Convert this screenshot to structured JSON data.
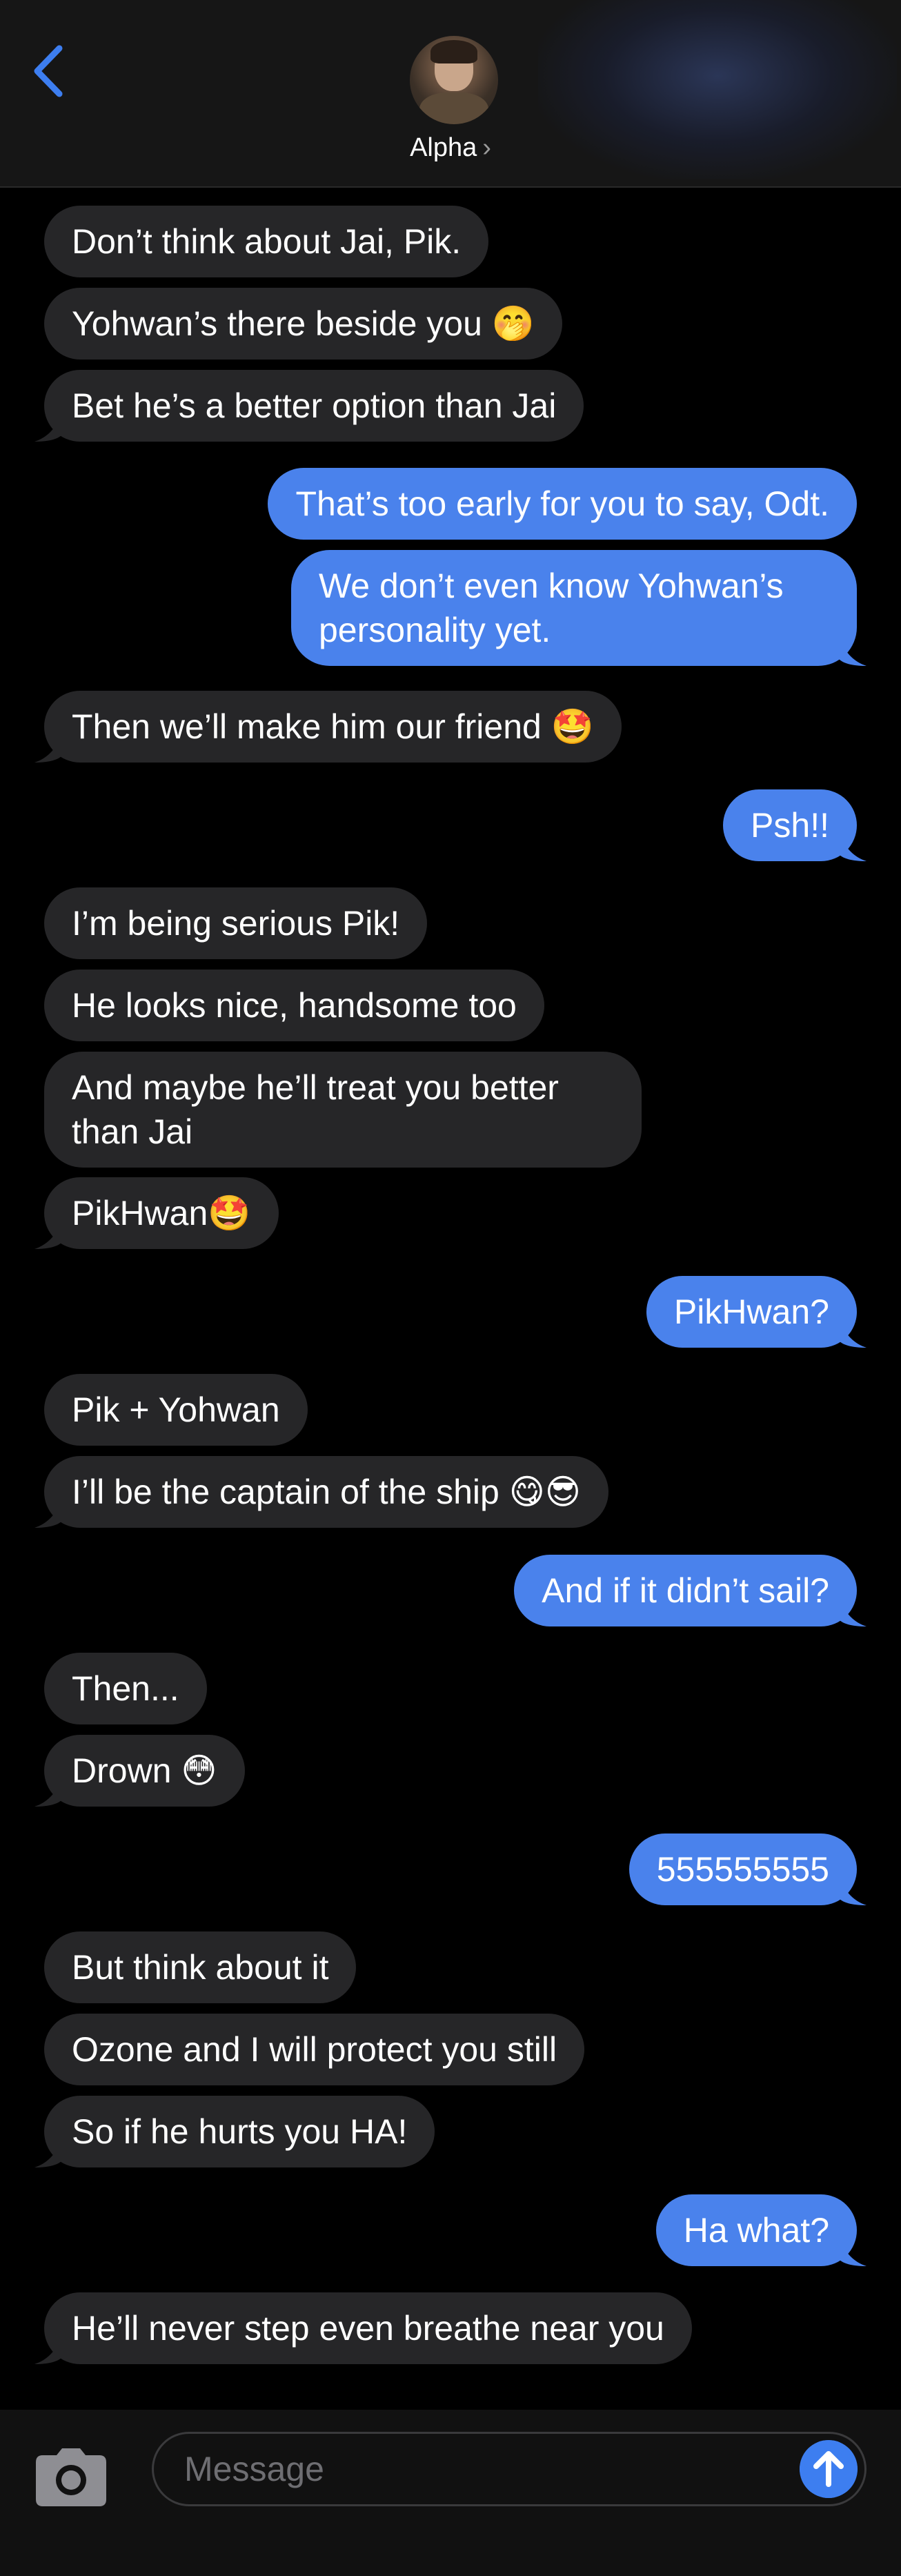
{
  "header": {
    "contact_name": "Alpha",
    "chevron": "›",
    "back_icon": "chevron-left-icon",
    "accent": "#4a82ec"
  },
  "messages": [
    {
      "dir": "in",
      "text": "Don’t think about Jai, Pik."
    },
    {
      "dir": "in",
      "text": "Yohwan’s there beside you 🤭"
    },
    {
      "dir": "in",
      "text": "Bet he’s a better option than Jai"
    },
    {
      "dir": "out",
      "text": "That’s too early for you to say, Odt."
    },
    {
      "dir": "out",
      "text": "We don’t even know Yohwan’s personality yet."
    },
    {
      "dir": "in",
      "text": "Then we’ll make him our friend 🤩"
    },
    {
      "dir": "out",
      "text": "Psh!!"
    },
    {
      "dir": "in",
      "text": "I’m being serious Pik!"
    },
    {
      "dir": "in",
      "text": "He looks nice, handsome too"
    },
    {
      "dir": "in",
      "text": "And maybe he’ll treat you better than Jai"
    },
    {
      "dir": "in",
      "text": "PikHwan🤩"
    },
    {
      "dir": "out",
      "text": "PikHwan?"
    },
    {
      "dir": "in",
      "text": "Pik + Yohwan"
    },
    {
      "dir": "in",
      "text": "I’ll be the captain of the ship 😋😎"
    },
    {
      "dir": "out",
      "text": "And if it didn’t sail?"
    },
    {
      "dir": "in",
      "text": "Then..."
    },
    {
      "dir": "in",
      "text": "Drown 😳"
    },
    {
      "dir": "out",
      "text": "555555555"
    },
    {
      "dir": "in",
      "text": "But think about it"
    },
    {
      "dir": "in",
      "text": "Ozone and I will protect you still"
    },
    {
      "dir": "in",
      "text": "So if he hurts you HA!"
    },
    {
      "dir": "out",
      "text": "Ha what?"
    },
    {
      "dir": "in",
      "text": "He’ll never step even breathe near you"
    }
  ],
  "input": {
    "placeholder": "Message",
    "camera_icon": "camera-icon",
    "send_icon": "send-arrow-up-icon"
  },
  "colors": {
    "incoming_bubble": "#262628",
    "outgoing_bubble": "#4a82ec",
    "background": "#000000"
  }
}
